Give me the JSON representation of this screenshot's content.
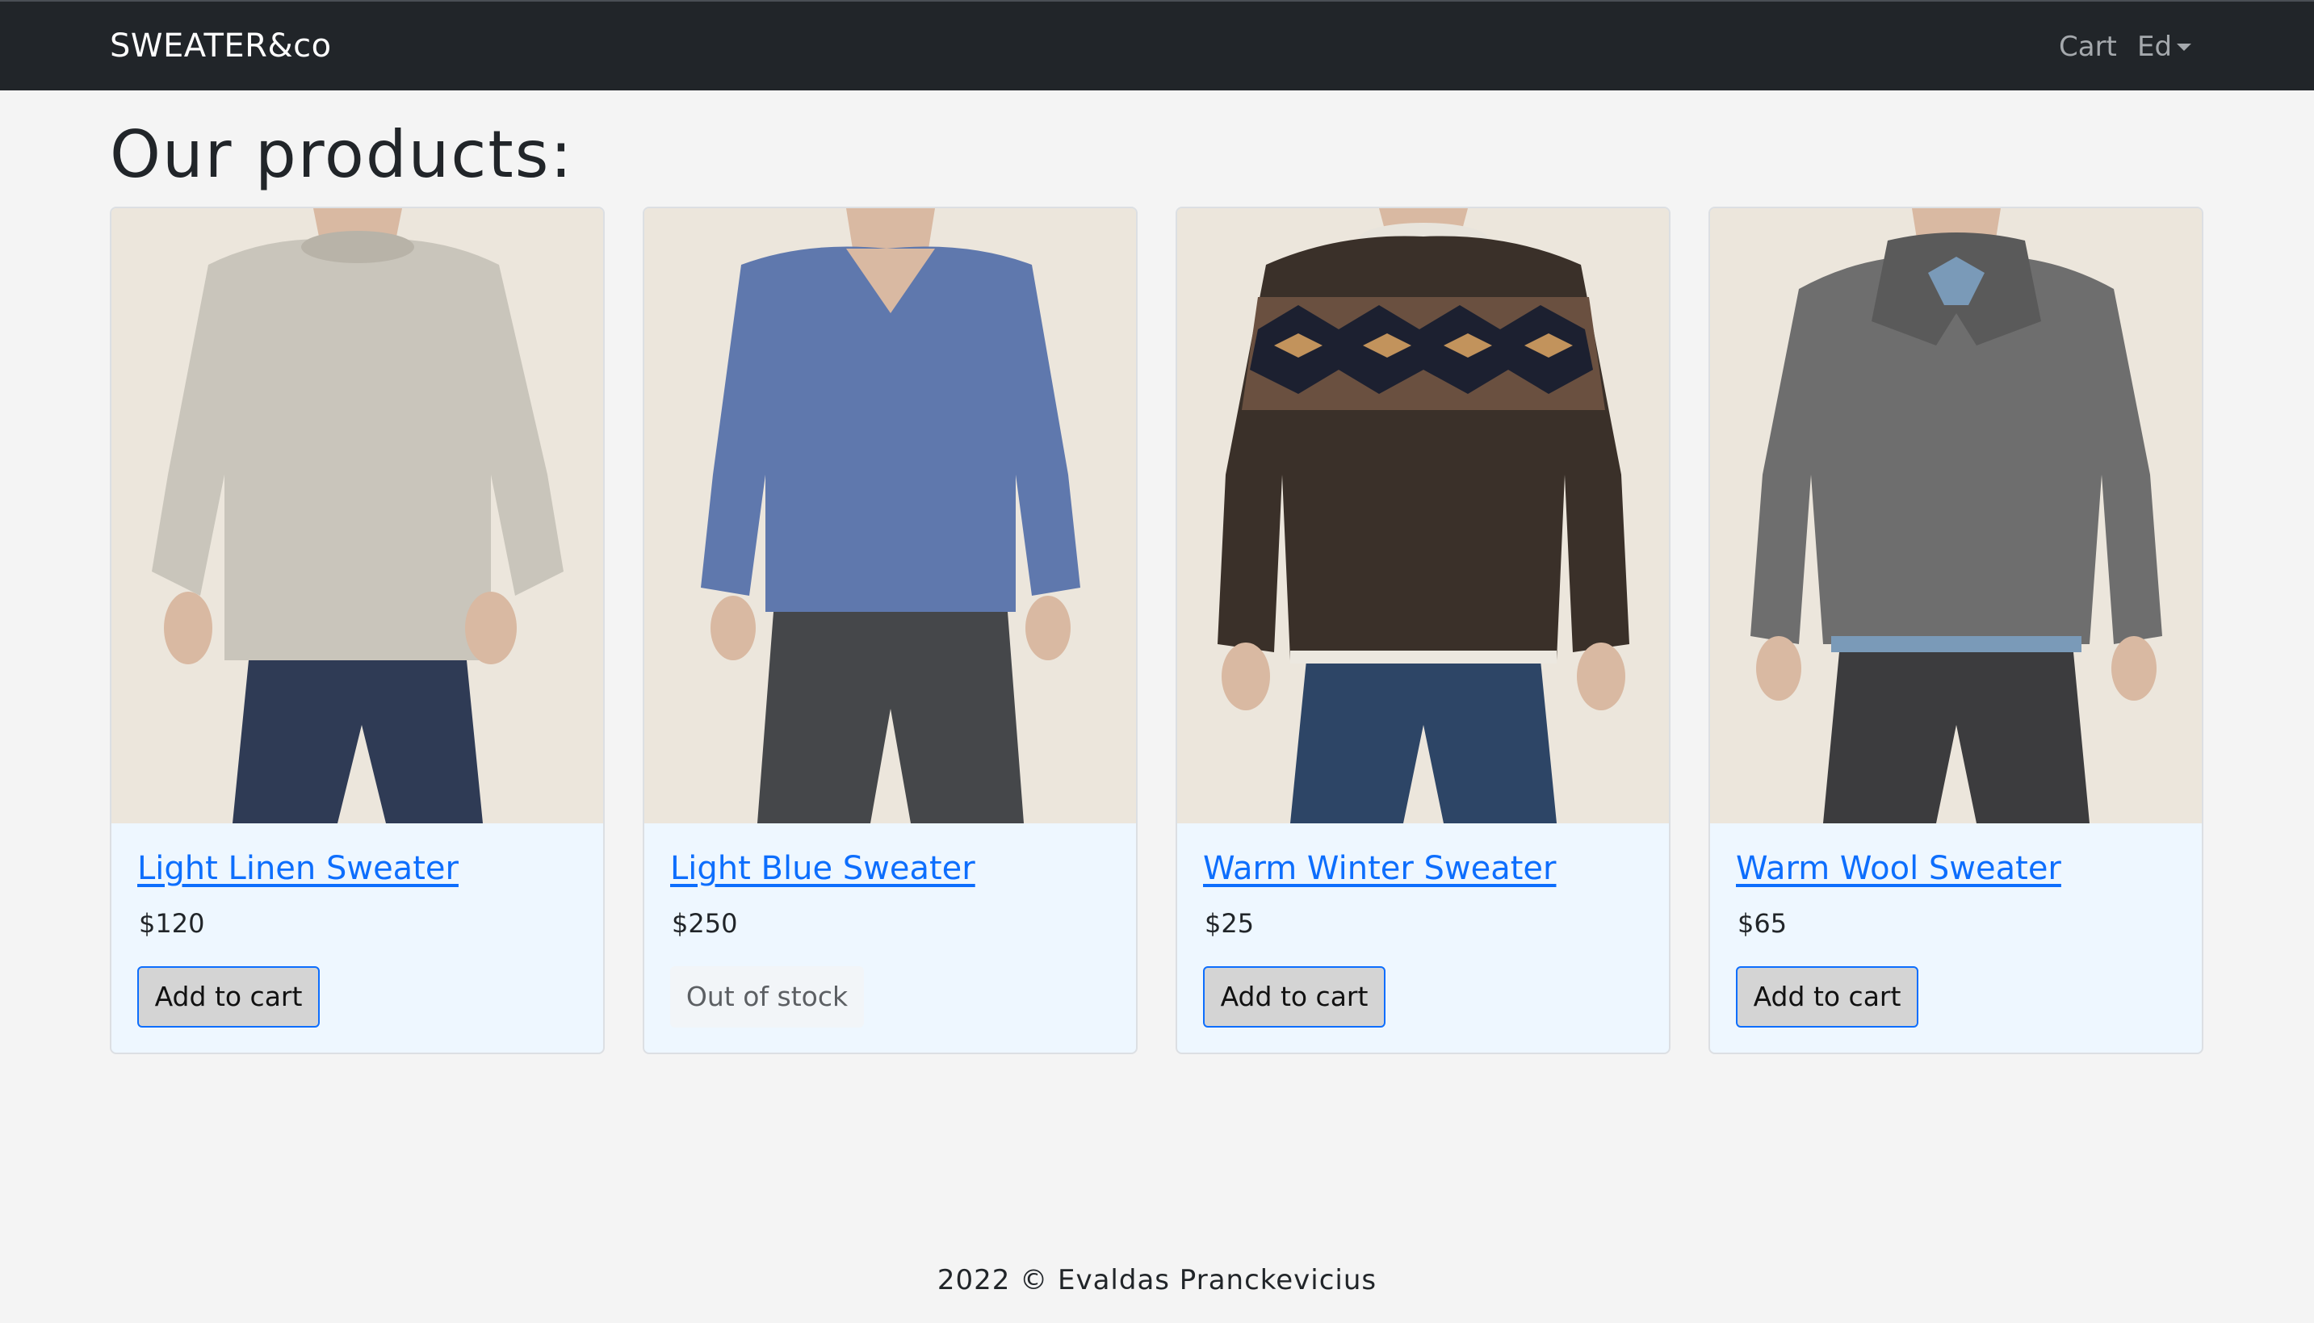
{
  "navbar": {
    "brand": "SWEATER&co",
    "cart_label": "Cart",
    "user_label": "Ed"
  },
  "main": {
    "title": "Our products:",
    "products": [
      {
        "name": "Light Linen Sweater",
        "price": "$120",
        "action": "Add to cart",
        "in_stock": true,
        "sweater_color": "#c9c5bb",
        "pants_color": "#2f3b55"
      },
      {
        "name": "Light Blue Sweater",
        "price": "$250",
        "action": "Out of stock",
        "in_stock": false,
        "sweater_color": "#5f78ad",
        "pants_color": "#45474a"
      },
      {
        "name": "Warm Winter Sweater",
        "price": "$25",
        "action": "Add to cart",
        "in_stock": true,
        "sweater_color": "#3a3029",
        "pants_color": "#2d4566"
      },
      {
        "name": "Warm Wool Sweater",
        "price": "$65",
        "action": "Add to cart",
        "in_stock": true,
        "sweater_color": "#6e6e6e",
        "pants_color": "#3c3c3e"
      }
    ]
  },
  "footer": {
    "text": "2022 © Evaldas Pranckevicius"
  }
}
